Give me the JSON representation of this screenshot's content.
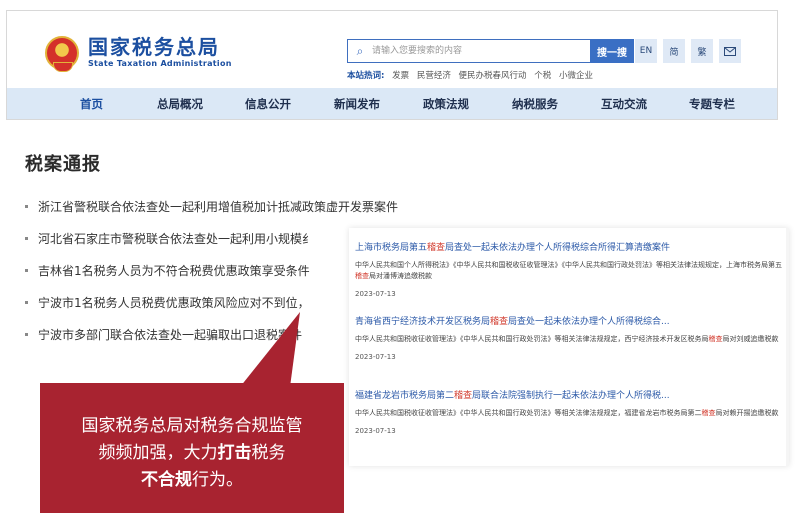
{
  "header": {
    "logo_cn": "国家税务总局",
    "logo_en": "State Taxation Administration",
    "search": {
      "placeholder": "请输入您要搜索的内容",
      "button_label": "搜一搜"
    },
    "hot_words_label": "本站热词:",
    "hot_words": [
      "发票",
      "民营经济",
      "便民办税春风行动",
      "个税",
      "小微企业"
    ],
    "lang_buttons": {
      "en": "EN",
      "simplified": "简",
      "traditional": "繁",
      "mail_icon": "mail-icon"
    },
    "nav": [
      "首页",
      "总局概况",
      "信息公开",
      "新闻发布",
      "政策法规",
      "纳税服务",
      "互动交流",
      "专题专栏"
    ]
  },
  "main": {
    "section_title": "税案通报",
    "news": [
      "浙江省警税联合依法查处一起利用增值税加计抵减政策虚开发票案件",
      "河北省石家庄市警税联合依法查处一起利用小规模纟",
      "吉林省1名税务人员为不符合税费优惠政策享受条件",
      "宁波市1名税务人员税费优惠政策风险应对不到位，",
      "宁波市多部门联合依法查处一起骗取出口退税案件"
    ]
  },
  "popup": {
    "results": [
      {
        "title_pre": "上海市税务局第五",
        "title_hl": "稽查",
        "title_post": "局查处一起未依法办理个人所得税综合所得汇算清缴案件",
        "body_pre": "中华人民共和国个人所得税法》《中华人民共和国税收征收管理法》《中华人民共和国行政处罚法》等相关法律法规规定，上海市税务局第五",
        "body_hl": "稽查",
        "body_post": "局对潘博涛追缴税款",
        "date": "2023-07-13"
      },
      {
        "title_pre": "青海省西宁经济技术开发区税务局",
        "title_hl": "稽查",
        "title_post": "局查处一起未依法办理个人所得税综合...",
        "body_pre": "中华人民共和国税收征收管理法》《中华人民共和国行政处罚法》等相关法律法规规定，西宁经济技术开发区税务局",
        "body_hl": "稽查",
        "body_post": "局对刘威追缴税款",
        "date": "2023-07-13"
      },
      {
        "title_pre": "福建省龙岩市税务局第二",
        "title_hl": "稽查",
        "title_post": "局联合法院强制执行一起未依法办理个人所得税...",
        "body_pre": "中华人民共和国税收征收管理法》《中华人民共和国行政处罚法》等相关法律法规规定，福建省龙岩市税务局第二",
        "body_hl": "稽查",
        "body_post": "局对赖开揚追缴税款",
        "date": "2023-07-13"
      }
    ]
  },
  "callout": {
    "line1": "国家税务总局对税务合规监管",
    "line2_pre": "频频加强，大力",
    "line2_bold": "打击",
    "line2_post": "税务",
    "line3_bold": "不合规",
    "line3_post": "行为。",
    "color": "#a82330"
  }
}
